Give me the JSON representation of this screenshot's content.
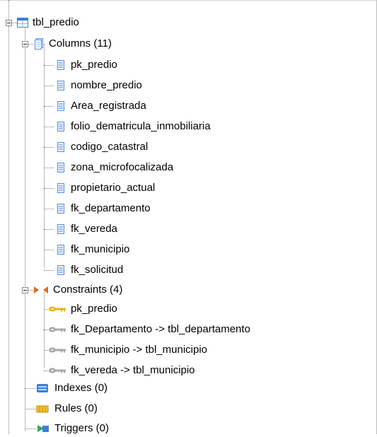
{
  "tree": {
    "table": {
      "label": "tbl_predio",
      "icon": "table-icon"
    },
    "columns": {
      "label": "Columns (11)",
      "icon": "columns-folder-icon",
      "items": [
        {
          "label": "pk_predio",
          "icon": "column-icon"
        },
        {
          "label": "nombre_predio",
          "icon": "column-icon"
        },
        {
          "label": "Area_registrada",
          "icon": "column-icon"
        },
        {
          "label": "folio_dematricula_inmobiliaria",
          "icon": "column-icon"
        },
        {
          "label": "codigo_catastral",
          "icon": "column-icon"
        },
        {
          "label": "zona_microfocalizada",
          "icon": "column-icon"
        },
        {
          "label": "propietario_actual",
          "icon": "column-icon"
        },
        {
          "label": "fk_departamento",
          "icon": "column-icon"
        },
        {
          "label": "fk_vereda",
          "icon": "column-icon"
        },
        {
          "label": "fk_municipio",
          "icon": "column-icon"
        },
        {
          "label": "fk_solicitud",
          "icon": "column-icon"
        }
      ]
    },
    "constraints": {
      "label": "Constraints (4)",
      "icon": "constraints-icon",
      "items": [
        {
          "label": "pk_predio",
          "icon": "primary-key-icon"
        },
        {
          "label": "fk_Departamento -> tbl_departamento",
          "icon": "foreign-key-icon"
        },
        {
          "label": "fk_municipio -> tbl_municipio",
          "icon": "foreign-key-icon"
        },
        {
          "label": "fk_vereda -> tbl_municipio",
          "icon": "foreign-key-icon"
        }
      ]
    },
    "indexes": {
      "label": "Indexes (0)",
      "icon": "indexes-icon"
    },
    "rules": {
      "label": "Rules (0)",
      "icon": "rules-icon"
    },
    "triggers": {
      "label": "Triggers (0)",
      "icon": "triggers-icon"
    }
  },
  "colors": {
    "table_blue": "#3d7fd6",
    "column_blue": "#5b8fd8",
    "pk_gold": "#e8b21c",
    "fk_gray": "#9a9a9a",
    "constraint_orange": "#e0691f"
  }
}
